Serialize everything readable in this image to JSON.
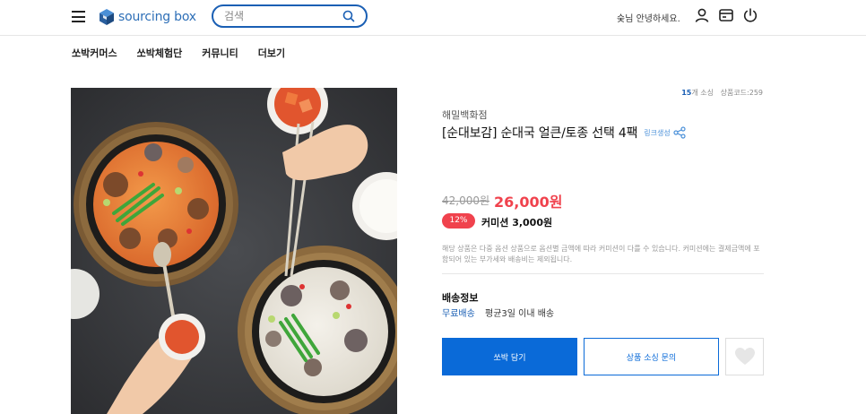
{
  "header": {
    "brand": "sourcing box",
    "search_placeholder": "검색",
    "greeting": "숮님 안녕하세요.",
    "icons": [
      "menu-icon",
      "user-icon",
      "wallet-icon",
      "power-icon",
      "search-icon"
    ]
  },
  "nav": [
    {
      "label": "쏘박커머스"
    },
    {
      "label": "쏘박체험단"
    },
    {
      "label": "커뮤니티"
    },
    {
      "label": "더보기"
    }
  ],
  "product": {
    "sourcing_count": "15",
    "sourcing_suffix": "개 소싱",
    "product_code": "상품코드:259",
    "store": "해밀백화점",
    "title": "[순대보감] 순대국 얼큰/토종 선택 4팩",
    "link_generate": "링크생성",
    "original_price": "42,000원",
    "sale_price": "26,000원",
    "commission_rate": "12%",
    "commission": "커미션 3,000원",
    "note": "해당 상품은 다중 옵션 상품으로 옵션별 금액에 따라 커미션이 다를 수 있습니다. 커미션에는 결제금액에 포함되어 있는 부가세와 배송비는 제외됩니다.",
    "shipping_title": "배송정보",
    "shipping_free": "무료배송",
    "shipping_avg": "평균3일 이내 배송",
    "btn_add": "쏘박 담기",
    "btn_inquiry": "상품 소싱 문의"
  },
  "colors": {
    "primary": "#0a6ad8",
    "sale": "#f0424d",
    "brand": "#2e6fb7"
  }
}
